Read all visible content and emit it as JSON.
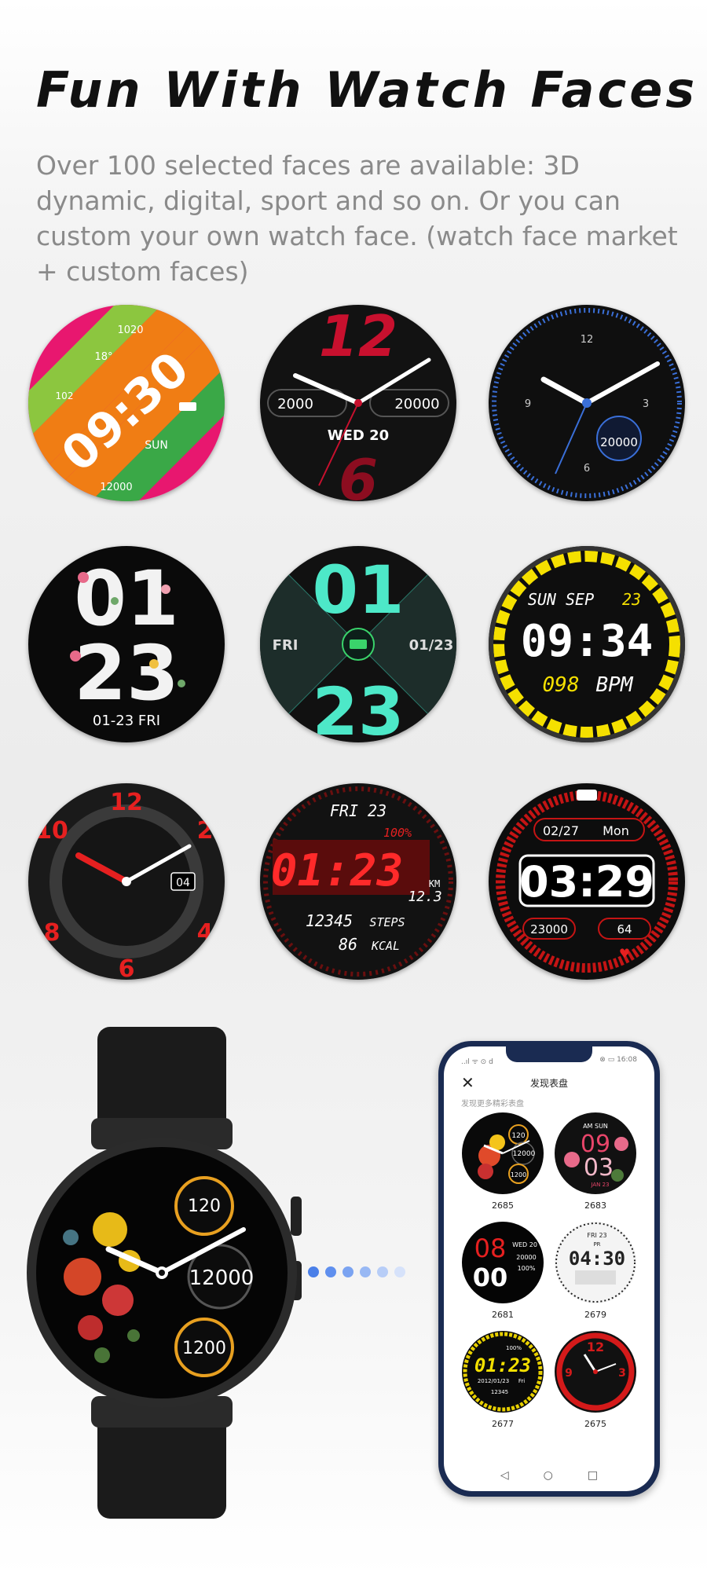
{
  "header": {
    "title": "Fun With Watch Faces",
    "description": "Over 100 selected faces are available: 3D dynamic, digital, sport and so on. Or you can custom your own watch face. (watch face market + custom faces)"
  },
  "faces": {
    "f1": {
      "time": "09:30",
      "top": "1020",
      "temp": "18°",
      "heart": "102",
      "day": "SUN",
      "steps": "12000"
    },
    "f2": {
      "top_num": "12",
      "bottom_num": "6",
      "left": "2000",
      "right": "20000",
      "date": "WED 20"
    },
    "f3": {
      "steps": "20000"
    },
    "f4": {
      "hours": "01",
      "minutes": "23",
      "date": "01-23 FRI"
    },
    "f5": {
      "hours": "01",
      "minutes": "23",
      "day": "FRI",
      "date": "01/23"
    },
    "f6": {
      "date": "SUN SEP",
      "day_num": "23",
      "time": "09:34",
      "bpm": "098",
      "bpm_label": "BPM"
    },
    "f7": {
      "badge": "04"
    },
    "f8": {
      "date": "FRI 23",
      "battery": "100%",
      "time": "01:23",
      "km_label": "KM",
      "km": "12.3",
      "steps": "12345",
      "steps_label": "STEPS",
      "kcal": "86",
      "kcal_label": "KCAL"
    },
    "f9": {
      "date": "02/27",
      "day": "Mon",
      "time": "03:29",
      "steps": "23000",
      "heart": "64"
    }
  },
  "watch": {
    "heart": "120",
    "steps": "12000",
    "kcal": "1200"
  },
  "pager": {
    "colors": [
      "#4a7fe8",
      "#5f8fee",
      "#7aa3f1",
      "#98b8f4",
      "#b7cdf7",
      "#d6e2fa"
    ]
  },
  "phone": {
    "status_left": "..ıl ᯤ ⊙ d",
    "status_right": "⊗ ▭ 16:08",
    "close": "✕",
    "title": "发现表盘",
    "subtitle": "发现更多精彩表盘",
    "items": [
      {
        "id": "2685",
        "line1": "120",
        "line2": "12000",
        "line3": "1200"
      },
      {
        "id": "2683",
        "line1": "AM SUN",
        "line2": "09",
        "line3": "03",
        "line4": "JAN 23"
      },
      {
        "id": "2681",
        "line1": "08",
        "line2": "00",
        "line3": "WED 20",
        "line4": "20000",
        "line5": "100%"
      },
      {
        "id": "2679",
        "line1": "FRI 23",
        "line2": "04:30",
        "line3": "PR"
      },
      {
        "id": "2677",
        "line1": "01:23",
        "line2": "2012/01/23",
        "line3": "Fri",
        "line4": "12345",
        "line5": "100%"
      },
      {
        "id": "2675",
        "line1": "12",
        "line2": "9",
        "line3": "3"
      }
    ],
    "nav": [
      "◁",
      "○",
      "□"
    ]
  }
}
